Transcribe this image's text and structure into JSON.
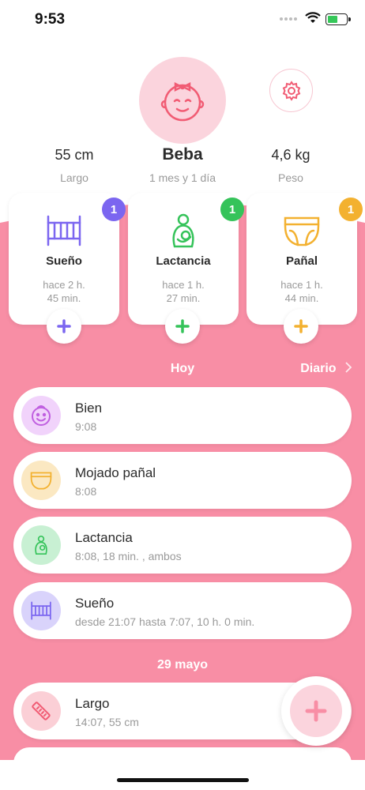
{
  "status_bar": {
    "time": "9:53"
  },
  "profile": {
    "name": "Beba",
    "age": "1 mes y 1 día",
    "length_value": "55 cm",
    "length_label": "Largo",
    "weight_value": "4,6 kg",
    "weight_label": "Peso",
    "avatar_icon": "baby-girl-face-icon",
    "settings_icon": "gear-icon"
  },
  "trackers": [
    {
      "title": "Sueño",
      "ago_line1": "hace  2 h.",
      "ago_line2": "45 min.",
      "badge": "1",
      "icon": "crib-icon",
      "color": "#7b66f0"
    },
    {
      "title": "Lactancia",
      "ago_line1": "hace  1 h.",
      "ago_line2": "27 min.",
      "badge": "1",
      "icon": "breastfeeding-icon",
      "color": "#35c35a"
    },
    {
      "title": "Pañal",
      "ago_line1": "hace  1 h.",
      "ago_line2": "44 min.",
      "badge": "1",
      "icon": "diaper-icon",
      "color": "#f3b130"
    }
  ],
  "feed": {
    "today_label": "Hoy",
    "diary_label": "Diario",
    "today_items": [
      {
        "title": "Bien",
        "subtitle": "9:08",
        "icon": "smiley-baby-icon",
        "bg": "#f1d3fb",
        "color": "#c05fe0"
      },
      {
        "title": "Mojado pañal",
        "subtitle": "8:08",
        "icon": "diaper-icon",
        "bg": "#fbe8c2",
        "color": "#f3b130"
      },
      {
        "title": "Lactancia",
        "subtitle": "8:08, 18 min. , ambos",
        "icon": "breastfeeding-icon",
        "bg": "#c8f0d3",
        "color": "#35c35a"
      },
      {
        "title": "Sueño",
        "subtitle": "desde 21:07 hasta 7:07, 10 h. 0 min.",
        "icon": "crib-icon",
        "bg": "#d9d3fb",
        "color": "#7b66f0"
      }
    ],
    "date_label": "29 mayo",
    "date_items": [
      {
        "title": "Largo",
        "subtitle": "14:07, 55 cm",
        "icon": "ruler-icon",
        "bg": "#fbcfd6",
        "color": "#f15c74"
      }
    ]
  },
  "fab": {
    "icon": "plus-icon",
    "color": "#f88ea5"
  },
  "colors": {
    "accent_pink": "#f88ea5",
    "avatar_bg": "#fbd4dd"
  }
}
